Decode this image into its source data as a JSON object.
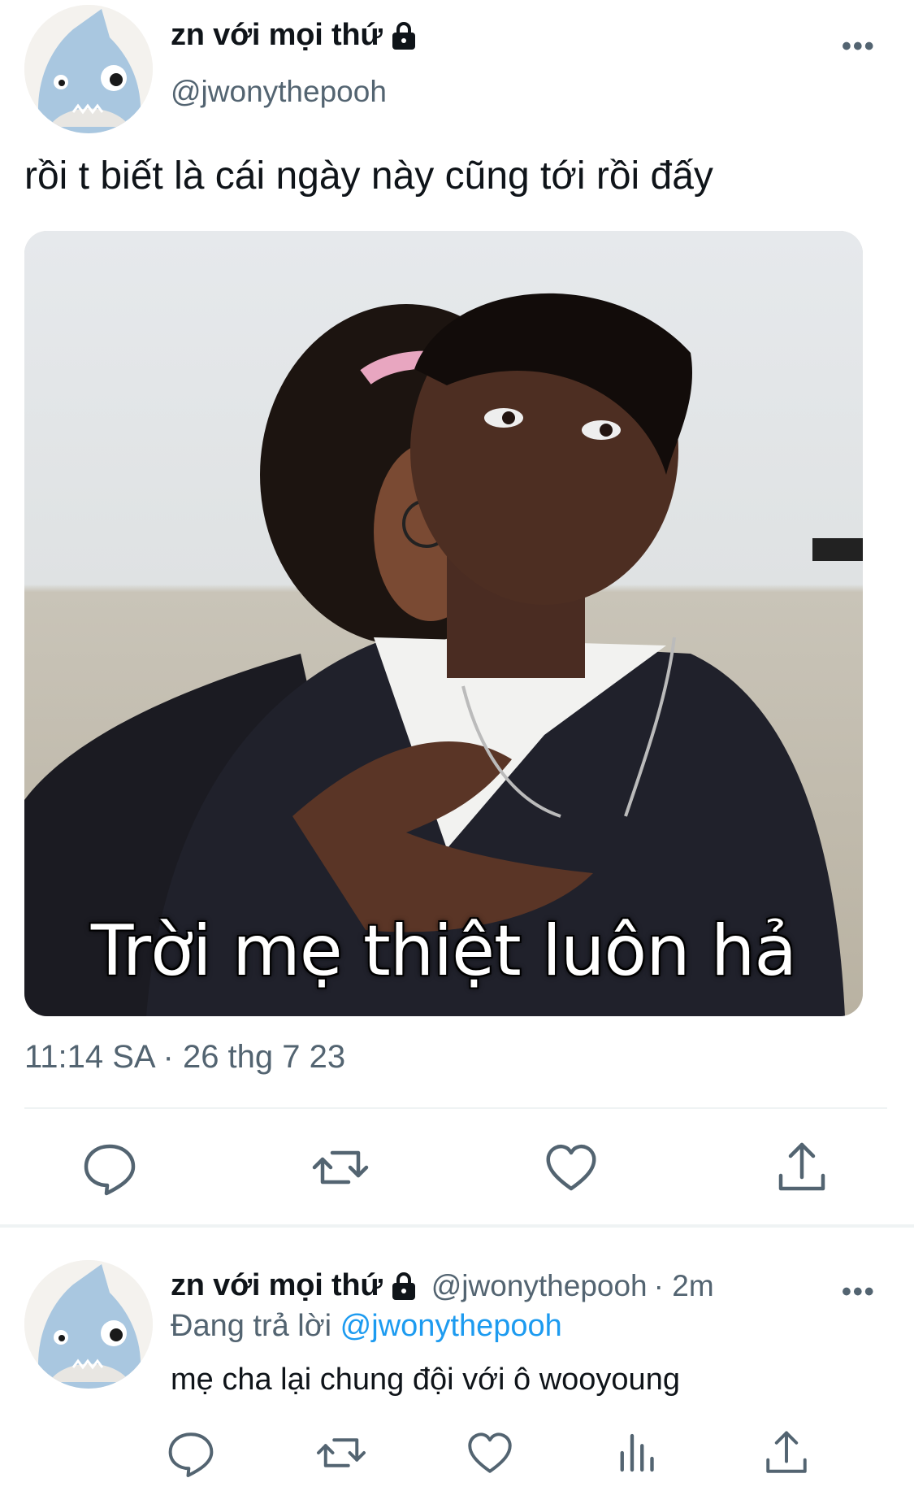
{
  "tweet": {
    "author_name": "zn với mọi thứ",
    "author_handle": "@jwonythepooh",
    "more_label": "•••",
    "text": "rồi t biết là cái ngày này cũng tới rồi đấy",
    "media": {
      "caption": "Trời mẹ thiệt luôn hả"
    },
    "timestamp": "11:14 SA · 26 thg 7 23",
    "actions": [
      "reply-icon",
      "retweet-icon",
      "like-icon",
      "share-icon"
    ]
  },
  "reply": {
    "author_name": "zn với mọi thứ",
    "author_handle": "@jwonythepooh",
    "time": "· 2m",
    "more_label": "•••",
    "replying_prefix": "Đang trả lời",
    "replying_to": "@jwonythepooh",
    "text": "mẹ cha lại chung đội với ô wooyoung",
    "actions": [
      "reply-icon",
      "retweet-icon",
      "like-icon",
      "views-icon",
      "share-icon"
    ]
  },
  "colors": {
    "text": "#0f1419",
    "secondary": "#536471",
    "accent": "#1d9bf0",
    "divider": "#eff3f4"
  }
}
